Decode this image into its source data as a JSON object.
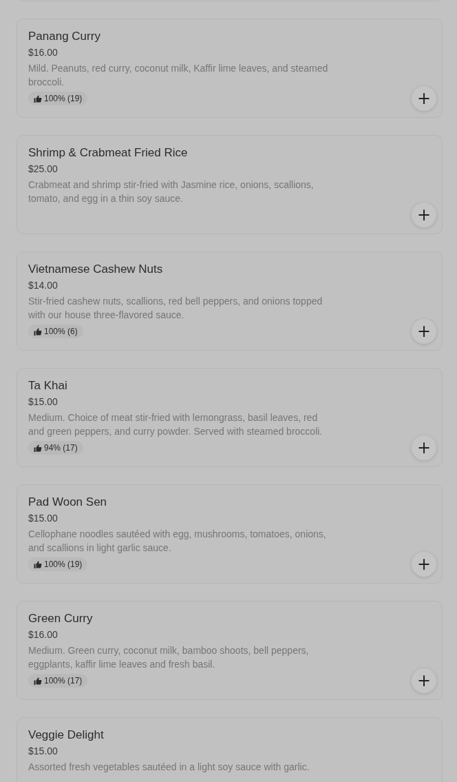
{
  "items": [
    {
      "name": "Panang Curry",
      "price": "$16.00",
      "description": "Mild. Peanuts, red curry, coconut milk, Kaffir lime leaves, and steamed broccoli.",
      "rating": "100% (19)",
      "add": "+"
    },
    {
      "name": "Shrimp & Crabmeat Fried Rice",
      "price": "$25.00",
      "description": "Crabmeat and shrimp stir-fried with Jasmine rice, onions, scallions, tomato, and egg in a thin soy sauce.",
      "add": "+"
    },
    {
      "name": "Vietnamese Cashew Nuts",
      "price": "$14.00",
      "description": "Stir-fried cashew nuts, scallions, red bell peppers, and onions topped with our house three-flavored sauce.",
      "rating": "100% (6)",
      "add": "+"
    },
    {
      "name": "Ta Khai",
      "price": "$15.00",
      "description": "Medium. Choice of meat stir-fried with lemongrass, basil leaves, red and green peppers, and curry powder. Served with steamed broccoli.",
      "rating": "94% (17)",
      "add": "+"
    },
    {
      "name": "Pad Woon Sen",
      "price": "$15.00",
      "description": "Cellophane noodles sautéed with egg, mushrooms, tomatoes, onions, and scallions in light garlic sauce.",
      "rating": "100% (19)",
      "add": "+"
    },
    {
      "name": "Green Curry",
      "price": "$16.00",
      "description": "Medium. Green curry, coconut milk, bamboo shoots, bell peppers, eggplants, kaffir lime leaves and fresh basil.",
      "rating": "100% (17)",
      "add": "+"
    },
    {
      "name": "Veggie Delight",
      "price": "$15.00",
      "description": "Assorted fresh vegetables sautéed in a light soy sauce with garlic."
    }
  ]
}
